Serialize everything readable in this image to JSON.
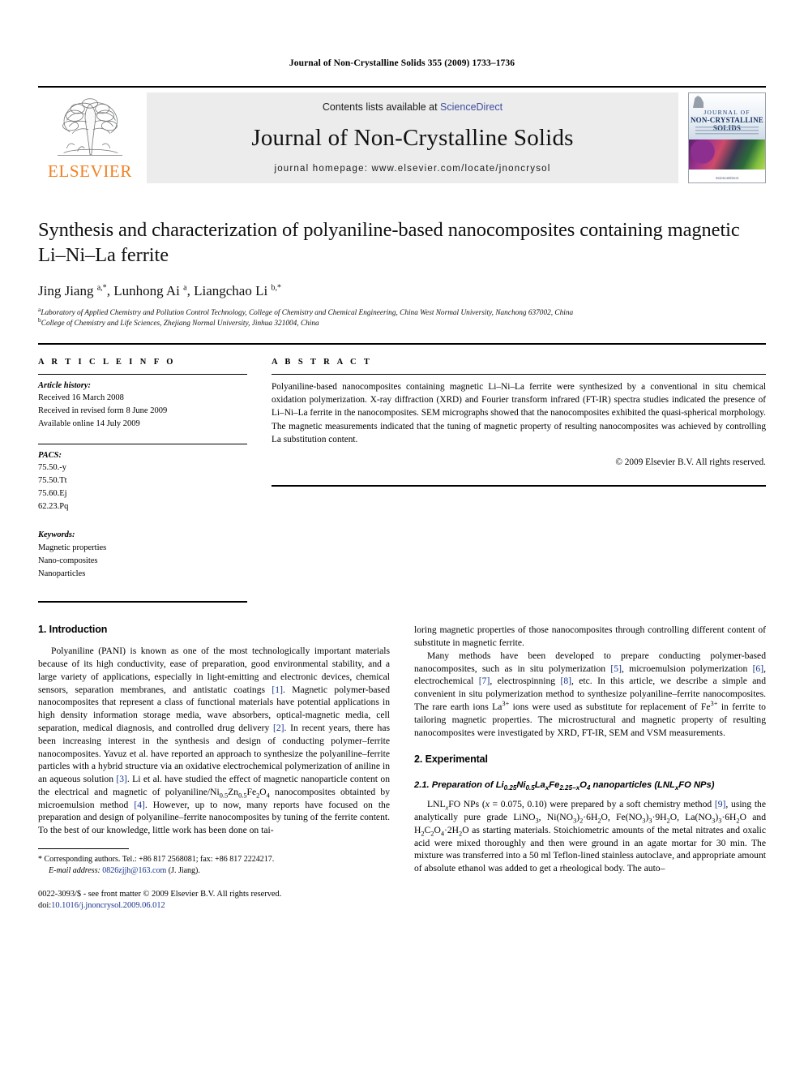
{
  "running_head": "Journal of Non-Crystalline Solids 355 (2009) 1733–1736",
  "masthead": {
    "publisher_wordmark": "ELSEVIER",
    "contents_prefix": "Contents lists available at ",
    "sciencedirect_link": "ScienceDirect",
    "journal_title": "Journal of Non-Crystalline Solids",
    "homepage_line": "journal homepage: www.elsevier.com/locate/jnoncrysol",
    "cover": {
      "line1": "JOURNAL OF",
      "line2": "NON-CRYSTALLINE SOLIDS",
      "footer_mark": "ScienceDirect"
    },
    "link_color": "#3b4fa0",
    "elsevier_orange": "#F08122"
  },
  "article": {
    "title": "Synthesis and characterization of polyaniline-based nanocomposites containing magnetic Li–Ni–La ferrite",
    "authors_html": "Jing Jiang <sup>a,*</sup>, Lunhong Ai <sup>a</sup>, Liangchao Li <sup>b,*</sup>",
    "affiliation_a": "Laboratory of Applied Chemistry and Pollution Control Technology, College of Chemistry and Chemical Engineering, China West Normal University, Nanchong 637002, China",
    "affiliation_b": "College of Chemistry and Life Sciences, Zhejiang Normal University, Jinhua 321004, China"
  },
  "article_info": {
    "heading": "A R T I C L E   I N F O",
    "history_label": "Article history:",
    "history": [
      "Received 16 March 2008",
      "Received in revised form 8 June 2009",
      "Available online 14 July 2009"
    ],
    "pacs_label": "PACS:",
    "pacs": [
      "75.50.-y",
      "75.50.Tt",
      "75.60.Ej",
      "62.23.Pq"
    ],
    "keywords_label": "Keywords:",
    "keywords": [
      "Magnetic properties",
      "Nano-composites",
      "Nanoparticles"
    ]
  },
  "abstract": {
    "heading": "A B S T R A C T",
    "text": "Polyaniline-based nanocomposites containing magnetic Li–Ni–La ferrite were synthesized by a conventional in situ chemical oxidation polymerization. X-ray diffraction (XRD) and Fourier transform infrared (FT-IR) spectra studies indicated the presence of Li–Ni–La ferrite in the nanocomposites. SEM micrographs showed that the nanocomposites exhibited the quasi-spherical morphology. The magnetic measurements indicated that the tuning of magnetic property of resulting nanocomposites was achieved by controlling La substitution content.",
    "copyright": "© 2009 Elsevier B.V. All rights reserved."
  },
  "sections": {
    "intro_heading": "1. Introduction",
    "experimental_heading": "2. Experimental",
    "subsection_2_1_html": "2.1. Preparation of Li<sub>0.25</sub>Ni<sub>0.5</sub>La<sub><i>x</i></sub>Fe<sub>2.25−<i>x</i></sub>O<sub>4</sub> nanoparticles (LNL<sub><i>x</i></sub>FO NPs)"
  },
  "paragraphs": {
    "intro_p1_html": "Polyaniline (PANI) is known as one of the most technologically important materials because of its high conductivity, ease of preparation, good environmental stability, and a large variety of applications, especially in light-emitting and electronic devices, chemical sensors, separation membranes, and antistatic coatings <span class=\"ref\">[1]</span>. Magnetic polymer-based nanocomposites that represent a class of functional materials have potential applications in high density information storage media, wave absorbers, optical-magnetic media, cell separation, medical diagnosis, and controlled drug delivery <span class=\"ref\">[2]</span>. In recent years, there has been increasing interest in the synthesis and design of conducting polymer–ferrite nanocomposites. Yavuz et al. have reported an approach to synthesize the polyaniline–ferrite particles with a hybrid structure via an oxidative electrochemical polymerization of aniline in an aqueous solution <span class=\"ref\">[3]</span>. Li et al. have studied the effect of magnetic nanoparticle content on the electrical and magnetic of polyaniline/Ni<sub>0.5</sub>Zn<sub>0.5</sub>Fe<sub>2</sub>O<sub>4</sub> nanocomposites obtainted by microemulsion method <span class=\"ref\">[4]</span>. However, up to now, many reports have focused on the preparation and design of polyaniline–ferrite nanocomposites by tuning of the ferrite content. To the best of our knowledge, little work has been done on tailoring magnetic properties of those nanocomposites through controlling different content of substitute in magnetic ferrite.",
    "intro_p2_html": "Many methods have been developed to prepare conducting polymer-based nanocomposites, such as in situ polymerization <span class=\"ref\">[5]</span>, microemulsion polymerization <span class=\"ref\">[6]</span>, electrochemical <span class=\"ref\">[7]</span>, electrospinning <span class=\"ref\">[8]</span>, etc. In this article, we describe a simple and convenient in situ polymerization method to synthesize polyaniline–ferrite nanocomposites. The rare earth ions La<sup>3+</sup> ions were used as substitute for replacement of Fe<sup>3+</sup> in ferrite to tailoring magnetic properties. The microstructural and magnetic property of resulting nanocomposites were investigated by XRD, FT-IR, SEM and VSM measurements.",
    "exp_p1_html": "LNL<sub><i>x</i></sub>FO NPs (<i>x</i> = 0.075, 0.10) were prepared by a soft chemistry method <span class=\"ref\">[9]</span>, using the analytically pure grade LiNO<sub>3</sub>, Ni(NO<sub>3</sub>)<sub>2</sub>·6H<sub>2</sub>O, Fe(NO<sub>3</sub>)<sub>3</sub>·9H<sub>2</sub>O, La(NO<sub>3</sub>)<sub>3</sub>·6H<sub>2</sub>O and H<sub>2</sub>C<sub>2</sub>O<sub>4</sub>·2H<sub>2</sub>O as starting materials. Stoichiometric amounts of the metal nitrates and oxalic acid were mixed thoroughly and then were ground in an agate mortar for 30 min. The mixture was transferred into a 50 ml Teflon-lined stainless autoclave, and appropriate amount of absolute ethanol was added to get a rheological body. The auto–"
  },
  "footnote": {
    "star": "*",
    "corresponding_html": "Corresponding authors. Tel.: +86 817 2568081; fax: +86 817 2224217.",
    "email_label": "E-mail address:",
    "email": "0826zjjh@163.com",
    "email_suffix": "(J. Jiang).",
    "issn_line": "0022-3093/$ - see front matter © 2009 Elsevier B.V. All rights reserved.",
    "doi_label": "doi:",
    "doi": "10.1016/j.jnoncrysol.2009.06.012"
  }
}
